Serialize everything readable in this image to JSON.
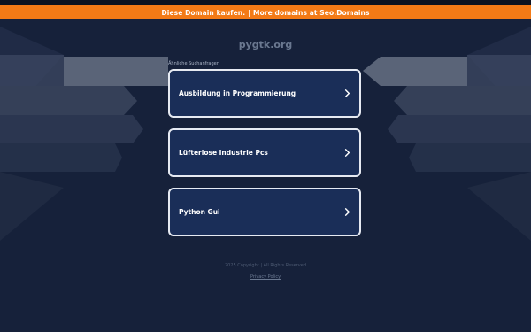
{
  "promo": {
    "left_text": "Diese Domain kaufen.",
    "separator": "|",
    "right_text": "More domains at Seo.Domains"
  },
  "domain": "pygtk.org",
  "related_label": "Ähnliche Suchanfragen",
  "links": [
    {
      "label": "Ausbildung in Programmierung"
    },
    {
      "label": "Lüfterlose Industrie Pcs"
    },
    {
      "label": "Python Gui"
    }
  ],
  "footer": {
    "copyright": "2025 Copyright | All Rights Reserved",
    "privacy": "Privacy Policy"
  },
  "colors": {
    "background": "#16213a",
    "promo_bar": "#f37a16",
    "card_fill": "#1a2e58",
    "card_border": "#e6eaf2"
  },
  "icons": [
    "chevron-right-icon"
  ]
}
